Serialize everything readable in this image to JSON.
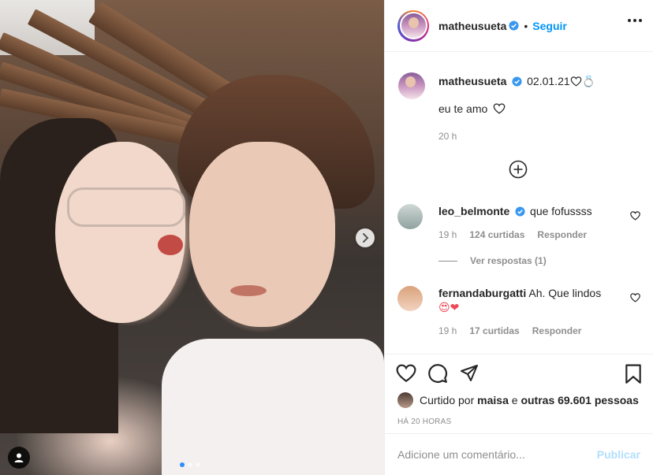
{
  "post": {
    "author": "matheusueta",
    "follow_label": "Seguir",
    "separator": "•",
    "image_alt": "",
    "carousel": {
      "total": 3,
      "active": 1
    }
  },
  "caption": {
    "username": "matheusueta",
    "title": "02.01.21",
    "emoji_suffix": "💍",
    "text": "eu te amo",
    "time": "20 h"
  },
  "comments": [
    {
      "username": "leo_belmonte",
      "verified": true,
      "text": "que fofussss",
      "time": "19 h",
      "likes": "124 curtidas",
      "reply": "Responder"
    },
    {
      "username": "fernandaburgatti",
      "verified": false,
      "text": "Ah. Que lindos",
      "emoji_line": "😍❤",
      "time": "19 h",
      "likes": "17 curtidas",
      "reply": "Responder"
    }
  ],
  "view_replies": "Ver respostas (1)",
  "likes_line": {
    "prefix": "Curtido por",
    "user": "maisa",
    "joiner": "e",
    "others": "outras 69.601 pessoas"
  },
  "posted_ago": "HÁ 20 HORAS",
  "add_comment": {
    "placeholder": "Adicione um comentário...",
    "publish_label": "Publicar"
  },
  "colors": {
    "accent": "#0095f6",
    "publish_disabled": "#b2dffc",
    "heart_red": "#ed4956",
    "muted": "#8e8e8e"
  },
  "icons": [
    "verified-icon",
    "more-icon",
    "heart-icon",
    "comment-icon",
    "share-icon",
    "bookmark-icon",
    "plus-circle-icon",
    "chevron-right-icon",
    "user-tag-icon"
  ]
}
